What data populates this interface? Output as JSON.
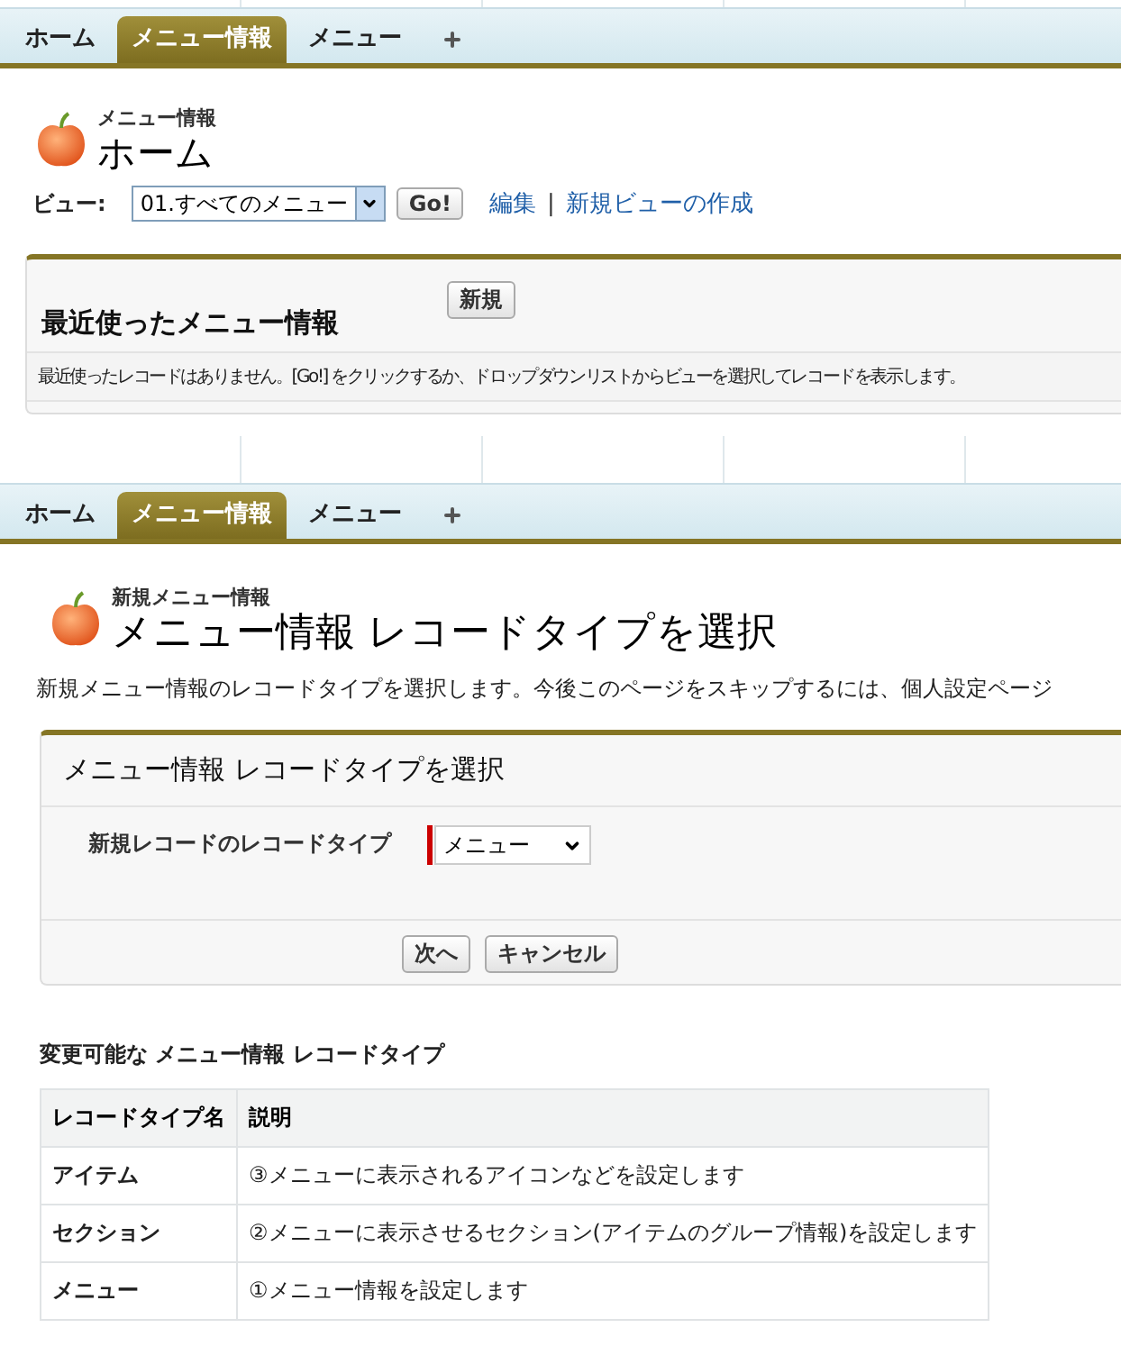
{
  "home_page": {
    "tabs": [
      {
        "label": "ホーム",
        "selected": false
      },
      {
        "label": "メニュー情報",
        "selected": true
      },
      {
        "label": "メニュー",
        "selected": false
      }
    ],
    "header": {
      "subtitle": "メニュー情報",
      "title": "ホーム"
    },
    "view": {
      "label": "ビュー:",
      "select": "01.すべてのメニュー",
      "go": "Go!",
      "links": [
        "編集",
        "新規ビューの作成"
      ],
      "separator": "|"
    },
    "recent": {
      "title": "最近使ったメニュー情報",
      "new_button": "新規",
      "message": "最近使ったレコードはありません。[Go!] をクリックするか、ドロップダウンリストからビューを選択してレコードを表示します。"
    }
  },
  "select_page": {
    "tabs": [
      {
        "label": "ホーム",
        "selected": false
      },
      {
        "label": "メニュー情報",
        "selected": true
      },
      {
        "label": "メニュー",
        "selected": false
      }
    ],
    "header": {
      "subtitle": "新規メニュー情報",
      "title": "メニュー情報 レコードタイプを選択"
    },
    "intro": "新規メニュー情報のレコードタイプを選択します。今後このページをスキップするには、個人設定ページ",
    "form": {
      "title": "メニュー情報 レコードタイプを選択",
      "field_label": "新規レコードのレコードタイプ",
      "required": true,
      "value": "メニュー",
      "buttons": [
        "次へ",
        "キャンセル"
      ]
    },
    "table": {
      "title": "変更可能な メニュー情報 レコードタイプ",
      "columns": [
        "レコードタイプ名",
        "説明"
      ],
      "rows": [
        [
          "アイテム",
          "③メニューに表示されるアイコンなどを設定します"
        ],
        [
          "セクション",
          "②メニューに表示させるセクション(アイテムのグループ情報)を設定します"
        ],
        [
          "メニュー",
          "①メニュー情報を設定します"
        ]
      ]
    }
  }
}
